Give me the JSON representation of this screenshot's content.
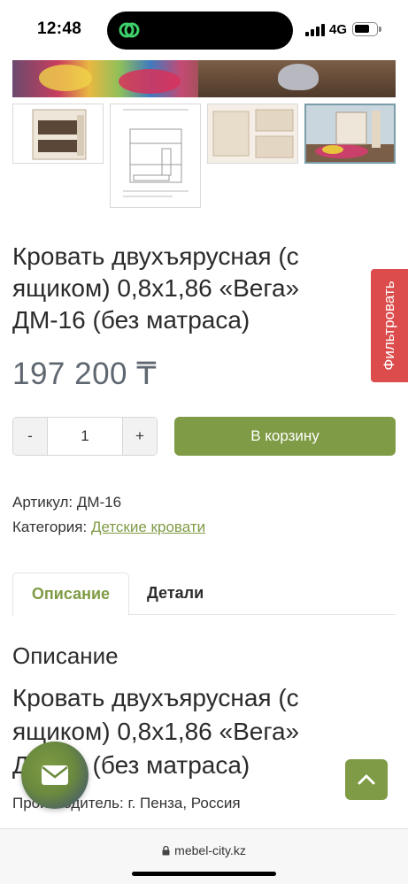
{
  "status_bar": {
    "time": "12:48",
    "network": "4G"
  },
  "product": {
    "title": "Кровать двухъярусная (с ящиком) 0,8х1,86 «Вега» ДМ-16 (без матраса)",
    "price": "197 200 ₸",
    "quantity": {
      "minus_label": "-",
      "value": "1",
      "plus_label": "+"
    },
    "add_to_cart_label": "В корзину",
    "sku_label": "Артикул:",
    "sku_value": "ДМ-16",
    "category_label": "Категория:",
    "category_value": "Детские кровати"
  },
  "filter_label": "Фильтровать",
  "tabs": [
    {
      "label": "Описание",
      "active": true
    },
    {
      "label": "Детали",
      "active": false
    }
  ],
  "description": {
    "heading": "Описание",
    "title": "Кровать двухъярусная (с ящиком) 0,8х1,86 «Вега» ДМ-16 (без матраса)",
    "manufacturer": "Производитель: г. Пенза, Россия"
  },
  "browser": {
    "url": "mebel-city.kz"
  },
  "colors": {
    "accent_green": "#7f9b45",
    "filter_red": "#dc4c4c",
    "price_gray": "#5f6770"
  },
  "icons": {
    "mail": "envelope-icon",
    "scroll_up": "chevron-up-icon",
    "lock": "lock-icon"
  }
}
